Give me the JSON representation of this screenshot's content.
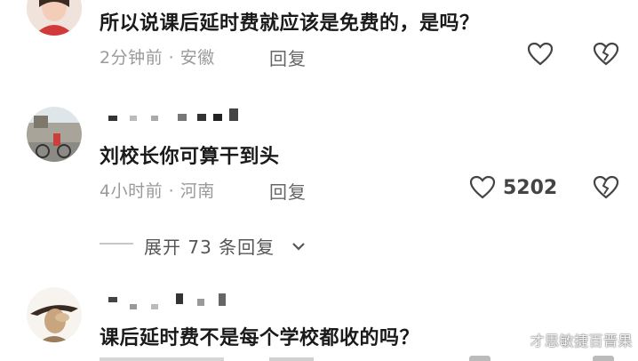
{
  "comments": [
    {
      "text": "所以说课后延时费就应该是免费的，是吗？",
      "time": "2分钟前",
      "region": "安徽",
      "reply_label": "回复"
    },
    {
      "text": "刘校长你可算干到头",
      "time": "4小时前",
      "region": "河南",
      "reply_label": "回复",
      "like_count": "5202",
      "expand_label": "展开 73 条回复"
    },
    {
      "text": "课后延时费不是每个学校都收的吗？"
    }
  ],
  "separator": "·",
  "watermark": "才思敏捷百晋果",
  "colors": {
    "text": "#1a1a1a",
    "meta": "#9a9a9a",
    "icon": "#444444"
  }
}
